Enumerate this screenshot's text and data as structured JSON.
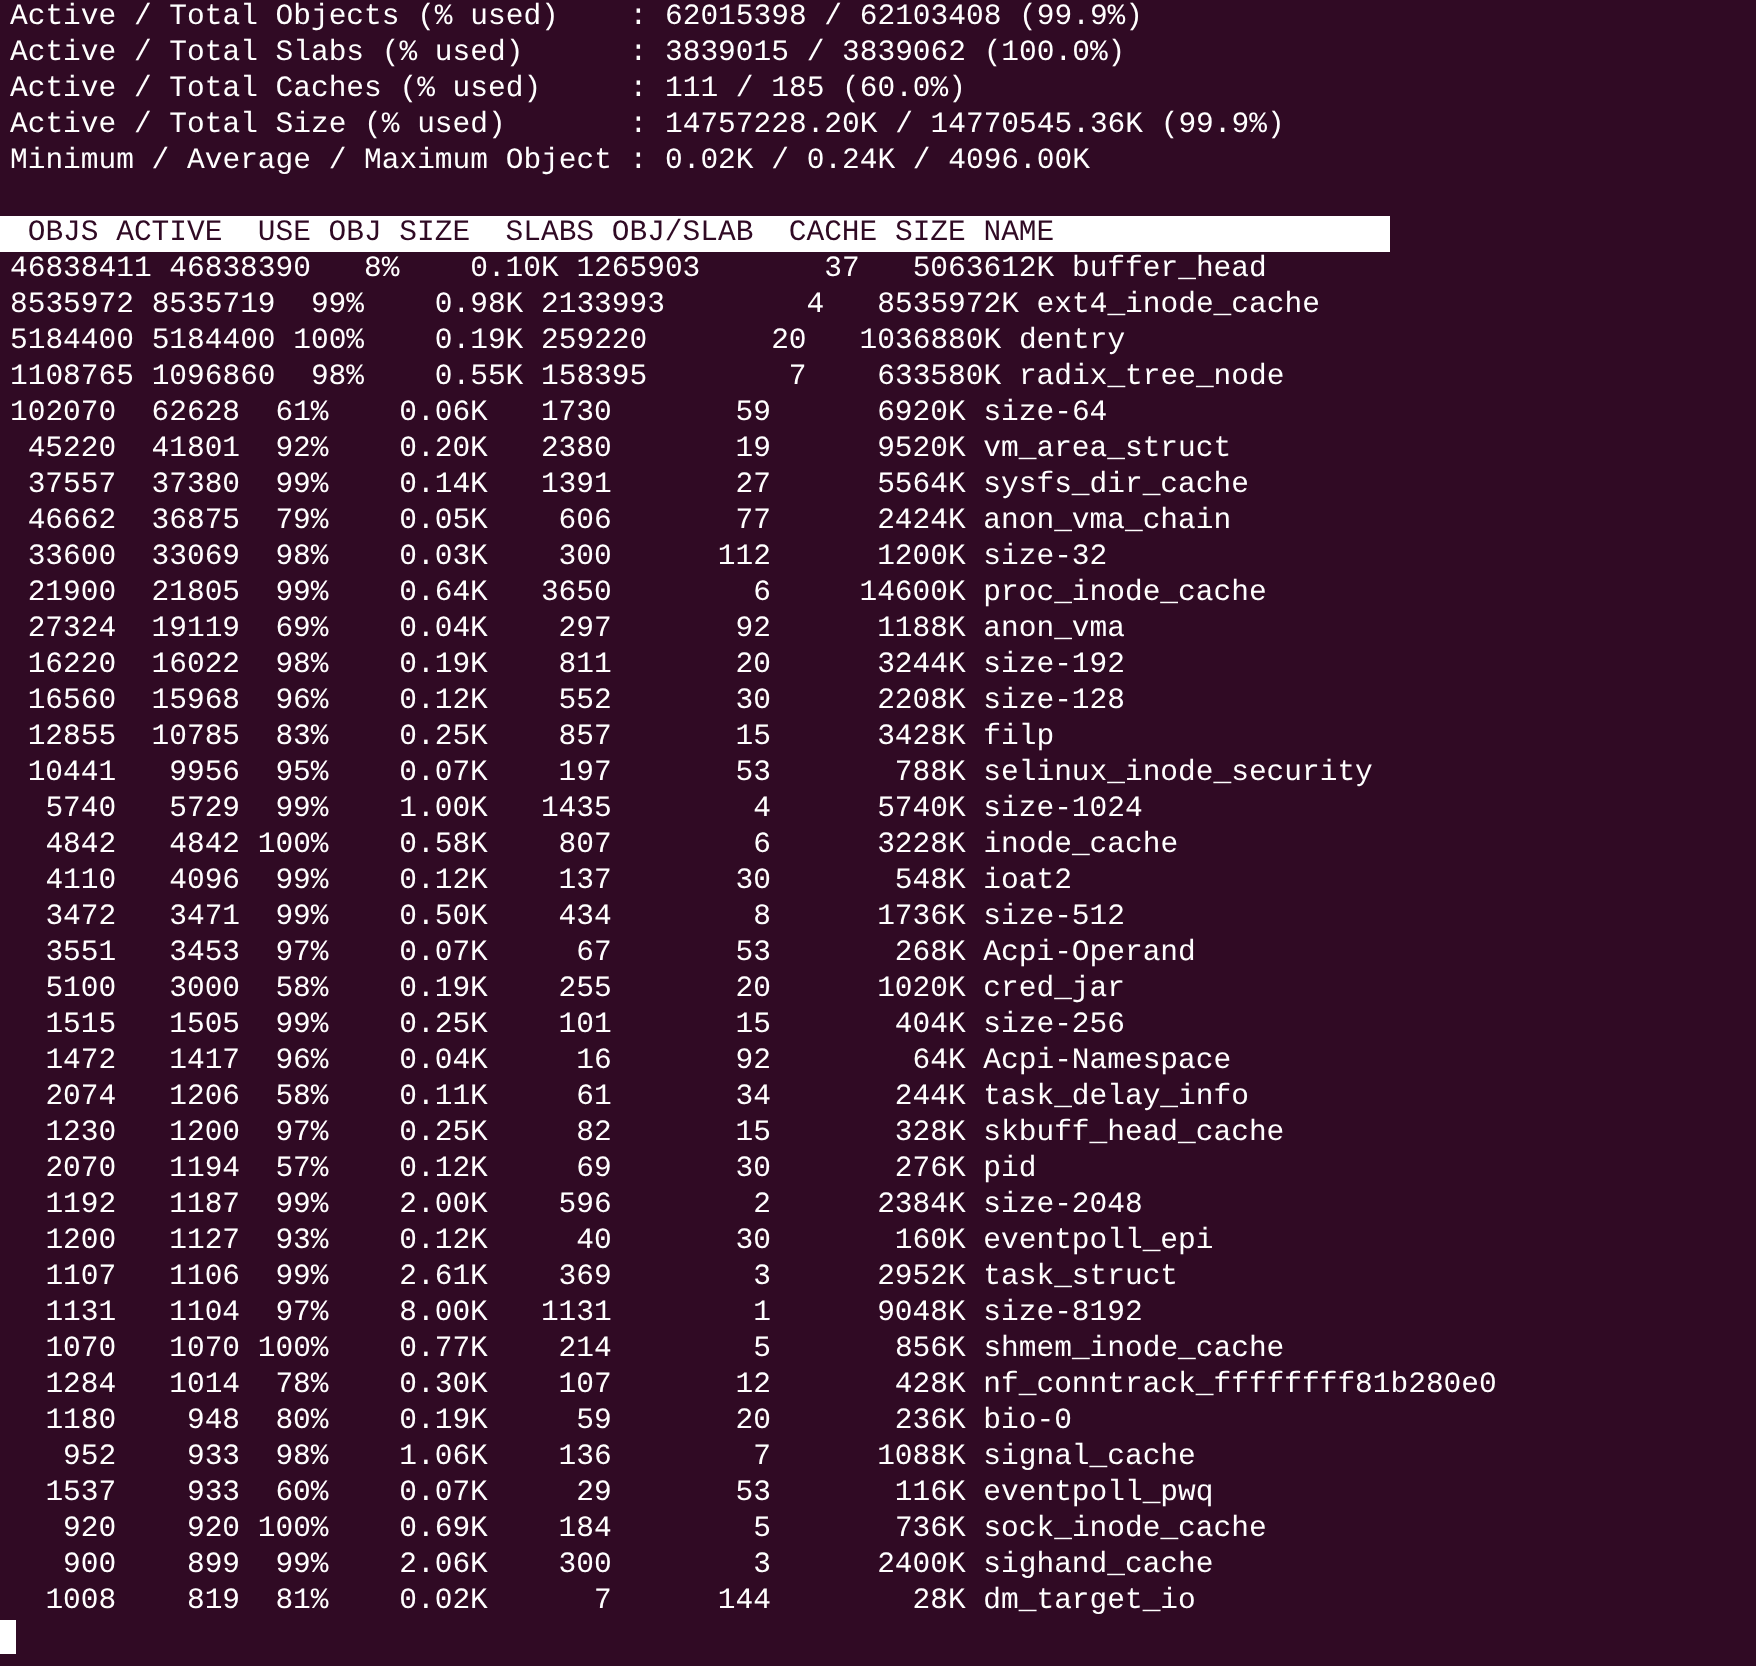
{
  "summary": [
    "Active / Total Objects (% used)    : 62015398 / 62103408 (99.9%)",
    "Active / Total Slabs (% used)      : 3839015 / 3839062 (100.0%)",
    "Active / Total Caches (% used)     : 111 / 185 (60.0%)",
    "Active / Total Size (% used)       : 14757228.20K / 14770545.36K (99.9%)",
    "Minimum / Average / Maximum Object : 0.02K / 0.24K / 4096.00K"
  ],
  "table": {
    "columns": [
      "OBJS",
      "ACTIVE",
      "USE",
      "OBJ SIZE",
      "SLABS",
      "OBJ/SLAB",
      "CACHE SIZE",
      "NAME"
    ],
    "rows": [
      [
        "46838411",
        "46838390",
        "8%",
        "0.10K",
        "1265903",
        "37",
        "5063612K",
        "buffer_head"
      ],
      [
        "8535972",
        "8535719",
        "99%",
        "0.98K",
        "2133993",
        "4",
        "8535972K",
        "ext4_inode_cache"
      ],
      [
        "5184400",
        "5184400",
        "100%",
        "0.19K",
        "259220",
        "20",
        "1036880K",
        "dentry"
      ],
      [
        "1108765",
        "1096860",
        "98%",
        "0.55K",
        "158395",
        "7",
        "633580K",
        "radix_tree_node"
      ],
      [
        "102070",
        "62628",
        "61%",
        "0.06K",
        "1730",
        "59",
        "6920K",
        "size-64"
      ],
      [
        "45220",
        "41801",
        "92%",
        "0.20K",
        "2380",
        "19",
        "9520K",
        "vm_area_struct"
      ],
      [
        "37557",
        "37380",
        "99%",
        "0.14K",
        "1391",
        "27",
        "5564K",
        "sysfs_dir_cache"
      ],
      [
        "46662",
        "36875",
        "79%",
        "0.05K",
        "606",
        "77",
        "2424K",
        "anon_vma_chain"
      ],
      [
        "33600",
        "33069",
        "98%",
        "0.03K",
        "300",
        "112",
        "1200K",
        "size-32"
      ],
      [
        "21900",
        "21805",
        "99%",
        "0.64K",
        "3650",
        "6",
        "14600K",
        "proc_inode_cache"
      ],
      [
        "27324",
        "19119",
        "69%",
        "0.04K",
        "297",
        "92",
        "1188K",
        "anon_vma"
      ],
      [
        "16220",
        "16022",
        "98%",
        "0.19K",
        "811",
        "20",
        "3244K",
        "size-192"
      ],
      [
        "16560",
        "15968",
        "96%",
        "0.12K",
        "552",
        "30",
        "2208K",
        "size-128"
      ],
      [
        "12855",
        "10785",
        "83%",
        "0.25K",
        "857",
        "15",
        "3428K",
        "filp"
      ],
      [
        "10441",
        "9956",
        "95%",
        "0.07K",
        "197",
        "53",
        "788K",
        "selinux_inode_security"
      ],
      [
        "5740",
        "5729",
        "99%",
        "1.00K",
        "1435",
        "4",
        "5740K",
        "size-1024"
      ],
      [
        "4842",
        "4842",
        "100%",
        "0.58K",
        "807",
        "6",
        "3228K",
        "inode_cache"
      ],
      [
        "4110",
        "4096",
        "99%",
        "0.12K",
        "137",
        "30",
        "548K",
        "ioat2"
      ],
      [
        "3472",
        "3471",
        "99%",
        "0.50K",
        "434",
        "8",
        "1736K",
        "size-512"
      ],
      [
        "3551",
        "3453",
        "97%",
        "0.07K",
        "67",
        "53",
        "268K",
        "Acpi-Operand"
      ],
      [
        "5100",
        "3000",
        "58%",
        "0.19K",
        "255",
        "20",
        "1020K",
        "cred_jar"
      ],
      [
        "1515",
        "1505",
        "99%",
        "0.25K",
        "101",
        "15",
        "404K",
        "size-256"
      ],
      [
        "1472",
        "1417",
        "96%",
        "0.04K",
        "16",
        "92",
        "64K",
        "Acpi-Namespace"
      ],
      [
        "2074",
        "1206",
        "58%",
        "0.11K",
        "61",
        "34",
        "244K",
        "task_delay_info"
      ],
      [
        "1230",
        "1200",
        "97%",
        "0.25K",
        "82",
        "15",
        "328K",
        "skbuff_head_cache"
      ],
      [
        "2070",
        "1194",
        "57%",
        "0.12K",
        "69",
        "30",
        "276K",
        "pid"
      ],
      [
        "1192",
        "1187",
        "99%",
        "2.00K",
        "596",
        "2",
        "2384K",
        "size-2048"
      ],
      [
        "1200",
        "1127",
        "93%",
        "0.12K",
        "40",
        "30",
        "160K",
        "eventpoll_epi"
      ],
      [
        "1107",
        "1106",
        "99%",
        "2.61K",
        "369",
        "3",
        "2952K",
        "task_struct"
      ],
      [
        "1131",
        "1104",
        "97%",
        "8.00K",
        "1131",
        "1",
        "9048K",
        "size-8192"
      ],
      [
        "1070",
        "1070",
        "100%",
        "0.77K",
        "214",
        "5",
        "856K",
        "shmem_inode_cache"
      ],
      [
        "1284",
        "1014",
        "78%",
        "0.30K",
        "107",
        "12",
        "428K",
        "nf_conntrack_ffffffff81b280e0"
      ],
      [
        "1180",
        "948",
        "80%",
        "0.19K",
        "59",
        "20",
        "236K",
        "bio-0"
      ],
      [
        "952",
        "933",
        "98%",
        "1.06K",
        "136",
        "7",
        "1088K",
        "signal_cache"
      ],
      [
        "1537",
        "933",
        "60%",
        "0.07K",
        "29",
        "53",
        "116K",
        "eventpoll_pwq"
      ],
      [
        "920",
        "920",
        "100%",
        "0.69K",
        "184",
        "5",
        "736K",
        "sock_inode_cache"
      ],
      [
        "900",
        "899",
        "99%",
        "2.06K",
        "300",
        "3",
        "2400K",
        "sighand_cache"
      ],
      [
        "1008",
        "819",
        "81%",
        "0.02K",
        "7",
        "144",
        "28K",
        "dm_target_io"
      ]
    ]
  }
}
